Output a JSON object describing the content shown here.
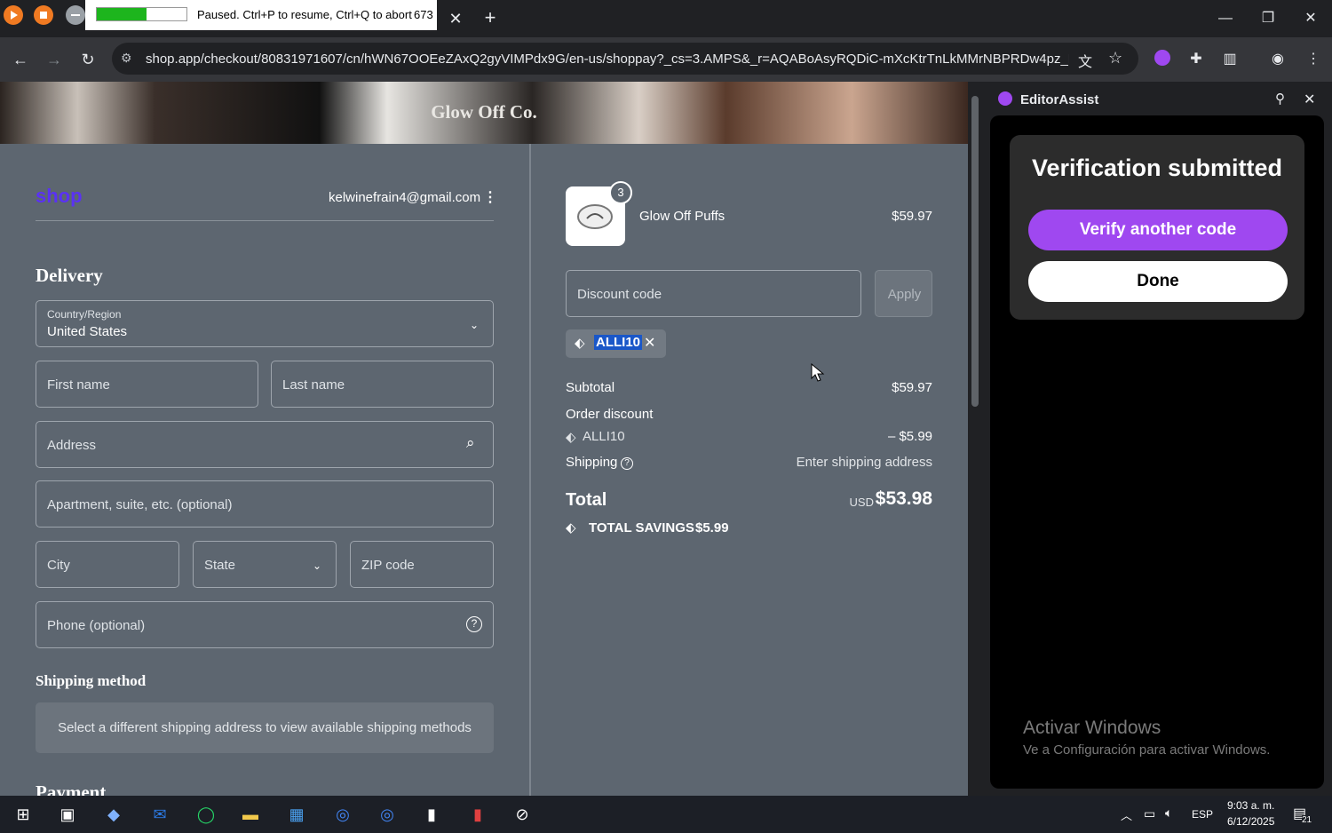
{
  "tab": {
    "title": "Paused. Ctrl+P to resume, Ctrl+Q to abort",
    "counter": "673",
    "progress": 0.55
  },
  "toolbar": {
    "url": "shop.app/checkout/80831971607/cn/hWN67OOEeZAxQ2gyVIMPdx9G/en-us/shoppay?_cs=3.AMPS&_r=AQABoAsyRQDiC-mXcKtrTnLkMMrNBPRDw4pz_BVBok..."
  },
  "store": {
    "name": "Glow Off Co."
  },
  "checkout": {
    "shop_logo": "shop",
    "email": "kelwinefrain4@gmail.com",
    "delivery_heading": "Delivery",
    "country_label": "Country/Region",
    "country_value": "United States",
    "first_name_placeholder": "First name",
    "last_name_placeholder": "Last name",
    "address_placeholder": "Address",
    "apartment_placeholder": "Apartment, suite, etc. (optional)",
    "city_placeholder": "City",
    "state_placeholder": "State",
    "zip_placeholder": "ZIP code",
    "phone_placeholder": "Phone (optional)",
    "shipping_heading": "Shipping method",
    "shipping_notice": "Select a different shipping address to view available shipping methods",
    "payment_heading": "Payment"
  },
  "summary": {
    "item_qty": "3",
    "item_name": "Glow Off Puffs",
    "item_price": "$59.97",
    "discount_placeholder": "Discount code",
    "apply_label": "Apply",
    "applied_code": "ALLI10",
    "subtotal_label": "Subtotal",
    "subtotal_value": "$59.97",
    "order_discount_label": "Order discount",
    "discount_code_line": "ALLI10",
    "discount_amount": "– $5.99",
    "shipping_label": "Shipping",
    "shipping_value": "Enter shipping address",
    "total_label": "Total",
    "currency": "USD",
    "total_value": "$53.98",
    "savings_label": "TOTAL SAVINGS",
    "savings_value": "$5.99"
  },
  "sidepanel": {
    "title": "EditorAssist",
    "heading": "Verification submitted",
    "verify_another": "Verify another code",
    "done": "Done",
    "watermark_title": "Activar Windows",
    "watermark_sub": "Ve a Configuración para activar Windows."
  },
  "taskbar": {
    "language": "ESP",
    "time": "9:03 a. m.",
    "date": "6/12/2025",
    "notifications": "21"
  },
  "colors": {
    "accent_purple": "#9f48f0",
    "page_bg": "#5d6670",
    "shop_purple": "#5a31f4"
  }
}
